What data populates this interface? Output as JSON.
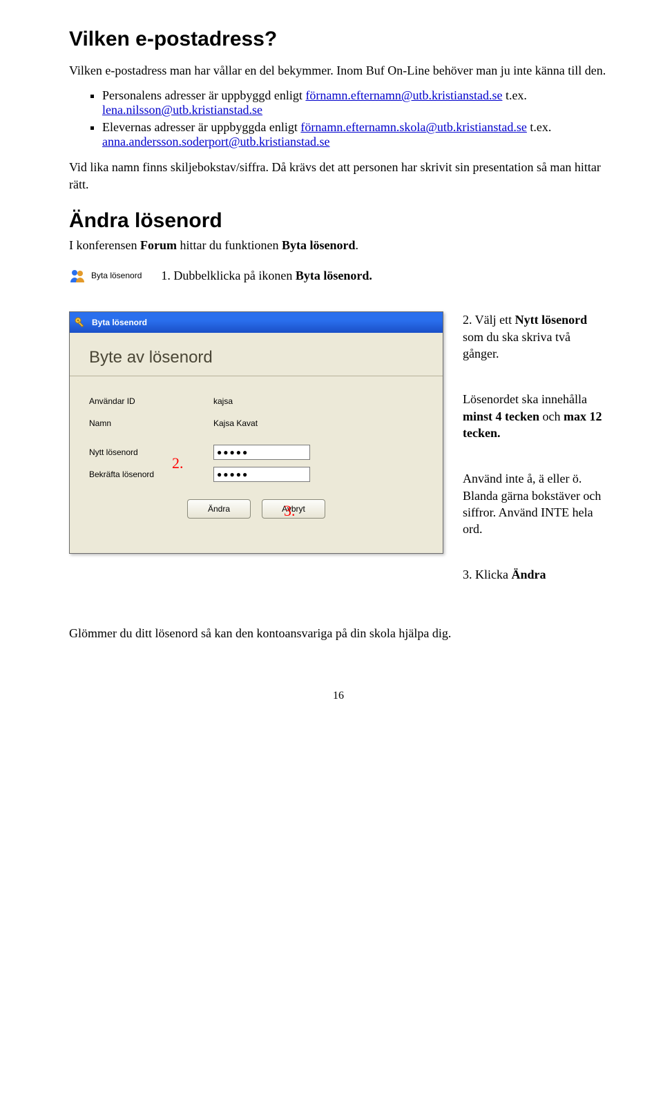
{
  "h1": "Vilken e-postadress?",
  "intro": "Vilken e-postadress man har vållar en del bekymmer. Inom Buf On-Line behöver man ju inte känna till den.",
  "bullet1_a": "Personalens adresser är uppbyggd enligt ",
  "bullet1_link": "förnamn.efternamn@utb.kristianstad.se",
  "bullet1_b": " t.ex. ",
  "bullet1_link2": "lena.nilsson@utb.kristianstad.se",
  "bullet2_a": "Elevernas adresser är uppbyggda enligt ",
  "bullet2_link": "förnamn.efternamn.skola@utb.kristianstad.se",
  "bullet2_b": " t.ex. ",
  "bullet2_link2": "anna.andersson.soderport@utb.kristianstad.se",
  "para_vid": "Vid lika namn finns skiljebokstav/siffra. Då krävs det att personen har skrivit sin presentation så man hittar rätt.",
  "h2": "Ändra lösenord",
  "para_konf_a": "I konferensen ",
  "para_konf_b": "Forum",
  "para_konf_c": " hittar du funktionen ",
  "para_konf_d": "Byta lösenord",
  "para_konf_e": ".",
  "bl_label": "Byta lösenord",
  "note1_a": "1. Dubbelklicka på ikonen ",
  "note1_b": "Byta lösenord.",
  "note2_a": "2. Välj ett ",
  "note2_b": "Nytt lösenord",
  "note2_c": " som du ska skriva två gånger.",
  "note3_a": "Lösenordet ska innehålla ",
  "note3_b": "minst 4 tecken",
  "note3_c": " och ",
  "note3_d": "max 12 tecken.",
  "note4": "Använd inte å, ä eller ö. Blanda gärna bokstäver och siffror. Använd INTE hela ord.",
  "note5_a": "3. Klicka ",
  "note5_b": "Ändra",
  "final": "Glömmer du ditt lösenord så kan den kontoansvariga på din skola hjälpa dig.",
  "pagenum": "16",
  "dialog": {
    "title": "Byta lösenord",
    "heading": "Byte av lösenord",
    "rows": {
      "user_lbl": "Användar ID",
      "user_val": "kajsa",
      "name_lbl": "Namn",
      "name_val": "Kajsa Kavat",
      "new_lbl": "Nytt lösenord",
      "conf_lbl": "Bekräfta lösenord"
    },
    "pw_mask": "●●●●●",
    "btn_change": "Ändra",
    "btn_cancel": "Avbryt",
    "annot2": "2.",
    "annot3": "3."
  }
}
